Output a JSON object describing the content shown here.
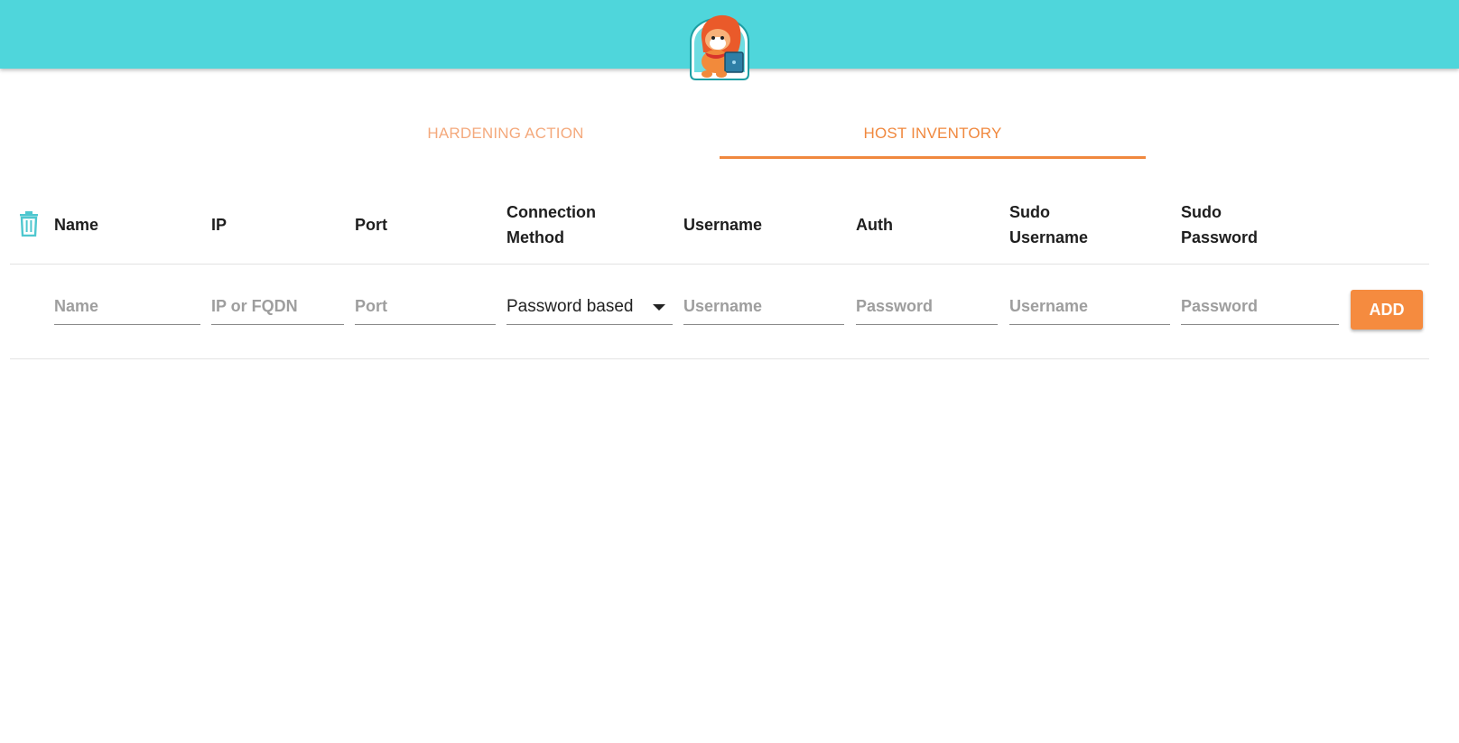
{
  "tabs": [
    {
      "label": "HARDENING ACTION",
      "active": false
    },
    {
      "label": "HOST INVENTORY",
      "active": true
    }
  ],
  "table": {
    "headers": {
      "name": "Name",
      "ip": "IP",
      "port": "Port",
      "connection_method_1": "Connection",
      "connection_method_2": "Method",
      "username": "Username",
      "auth": "Auth",
      "sudo_username_1": "Sudo",
      "sudo_username_2": "Username",
      "sudo_password_1": "Sudo",
      "sudo_password_2": "Password"
    },
    "inputs": {
      "name_placeholder": "Name",
      "ip_placeholder": "IP or FQDN",
      "port_placeholder": "Port",
      "connection_method_value": "Password based",
      "username_placeholder": "Username",
      "auth_placeholder": "Password",
      "sudo_username_placeholder": "Username",
      "sudo_password_placeholder": "Password"
    },
    "add_label": "ADD"
  },
  "icons": {
    "delete": "trash-icon",
    "logo": "mascot-logo",
    "dropdown": "caret-down-icon"
  },
  "colors": {
    "header_bar": "#4fd6db",
    "accent": "#f0883e",
    "tab_inactive": "#f4a97c",
    "add_button": "#f58b3f"
  }
}
